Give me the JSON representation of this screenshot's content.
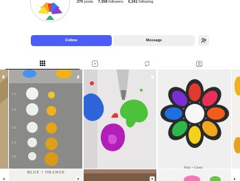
{
  "profile": {
    "posts_count": "270",
    "posts_label": "posts",
    "followers_count": "7,358",
    "followers_label": "followers",
    "following_count": "6,341",
    "following_label": "following"
  },
  "actions": {
    "follow_label": "Follow",
    "message_label": "Message",
    "follow_color": "#4a5df9"
  },
  "tabs": [
    {
      "icon": "grid-icon",
      "active": true
    },
    {
      "icon": "reels-icon",
      "active": false
    },
    {
      "icon": "repost-icon",
      "active": false
    },
    {
      "icon": "tagged-icon",
      "active": false
    }
  ],
  "posts": [
    {
      "caption": "BLUE + ORANGE"
    },
    {
      "caption": "Pink + Green"
    }
  ],
  "colors": {
    "accent": "#4a5df9",
    "button_grey": "#efefef"
  }
}
